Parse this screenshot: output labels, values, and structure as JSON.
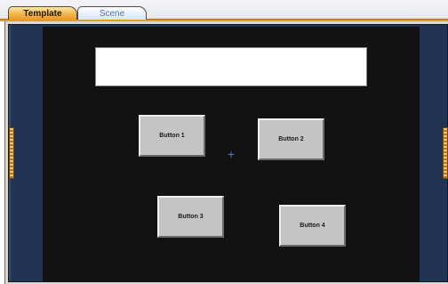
{
  "tabs": [
    {
      "label": "Template",
      "active": true
    },
    {
      "label": "Scene",
      "active": false
    }
  ],
  "canvas": {
    "buttons": [
      {
        "label": "Button 1"
      },
      {
        "label": "Button 2"
      },
      {
        "label": "Button 3"
      },
      {
        "label": "Button 4"
      }
    ]
  },
  "colors": {
    "active_tab": "#f3b64a",
    "panel": "#223453",
    "canvas": "#121212",
    "button": "#c4c4c4"
  },
  "icons": {
    "crosshair": "crosshair-icon",
    "splitter": "splitter-handle"
  }
}
